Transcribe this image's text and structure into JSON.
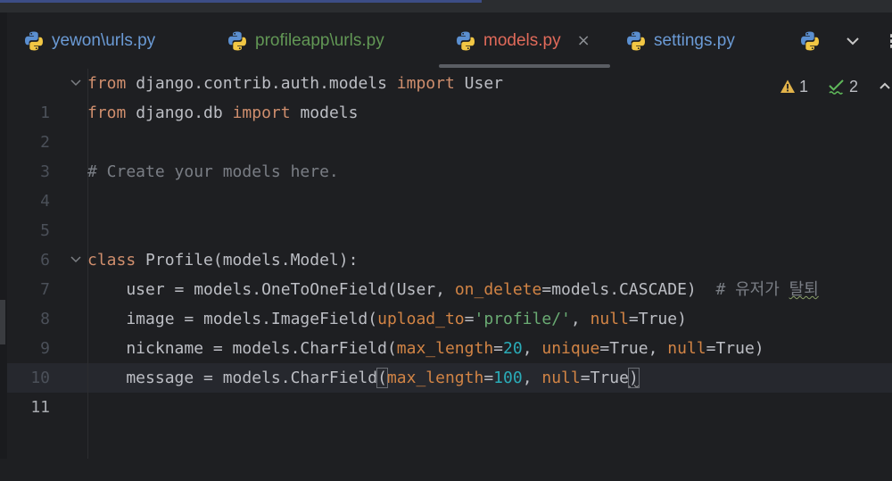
{
  "tabs": [
    {
      "label": "yewon\\urls.py",
      "icon": "python-icon",
      "active": false
    },
    {
      "label": "profileapp\\urls.py",
      "icon": "python-icon",
      "active": false
    },
    {
      "label": "models.py",
      "icon": "python-icon",
      "active": true
    },
    {
      "label": "settings.py",
      "icon": "python-icon",
      "active": false
    }
  ],
  "tab_close": "×",
  "menu_glyph": "⋮",
  "inspections": {
    "warnings": "1",
    "weak_warnings": "2"
  },
  "code": {
    "l1": {
      "num": "1",
      "kw1": "from",
      "mod": " django.contrib.auth.models ",
      "kw2": "import",
      "name": " User"
    },
    "l2": {
      "num": "2",
      "kw1": "from",
      "mod": " django.db ",
      "kw2": "import",
      "name": " models"
    },
    "l3": {
      "num": "3"
    },
    "l4": {
      "num": "4",
      "comment": "# Create your models here."
    },
    "l5": {
      "num": "5"
    },
    "l6": {
      "num": "6"
    },
    "l7": {
      "num": "7",
      "kw": "class",
      "rest": " Profile(models.Model):"
    },
    "l8": {
      "num": "8",
      "a": "    user = models.OneToOneField(User, ",
      "p": "on_delete",
      "b": "=models.CASCADE)  ",
      "comment": "# 유저가 ",
      "ctext": "탈퇴"
    },
    "l9": {
      "num": "9",
      "a": "    image = models.ImageField(",
      "p": "upload_to",
      "eq": "=",
      "s": "'profile/'",
      "c": ", ",
      "p2": "null",
      "d": "=True)"
    },
    "l10": {
      "num": "10",
      "a": "    nickname = models.CharField(",
      "p": "max_length",
      "eq": "=",
      "n": "20",
      "c": ", ",
      "p2": "unique",
      "d": "=True, ",
      "p3": "null",
      "e": "=True)"
    },
    "l11": {
      "num": "11",
      "a": "    message = models.CharField",
      "o": "(",
      "p": "max_length",
      "eq": "=",
      "n": "100",
      "c": ", ",
      "p2": "null",
      "d": "=",
      "v": "True",
      "cl": ")"
    }
  },
  "colors": {
    "background": "#1e1f22",
    "keyword": "#cf8e6d",
    "param": "#d28445",
    "string": "#6aab73",
    "number": "#2aacb8",
    "comment": "#7a7e85"
  }
}
